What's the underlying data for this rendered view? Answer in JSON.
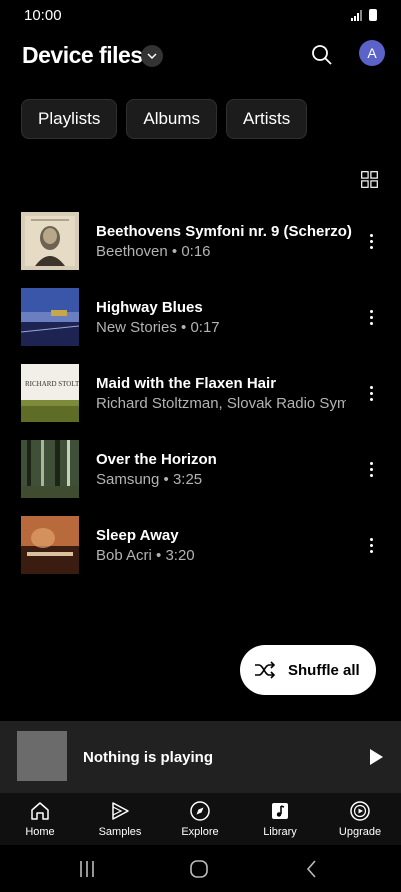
{
  "status_bar": {
    "time": "10:00"
  },
  "header": {
    "title": "Device files",
    "avatar_letter": "A"
  },
  "chips": [
    {
      "label": "Playlists"
    },
    {
      "label": "Albums"
    },
    {
      "label": "Artists"
    }
  ],
  "tracks": [
    {
      "title": "Beethovens Symfoni nr. 9 (Scherzo)",
      "subtitle": "Beethoven • 0:16",
      "art": "beethoven-portrait"
    },
    {
      "title": "Highway Blues",
      "subtitle": "New Stories • 0:17",
      "art": "blue-landscape"
    },
    {
      "title": "Maid with the Flaxen Hair",
      "subtitle": "Richard Stoltzman, Slovak Radio Sym…",
      "art_text": "RICHARD STOLTZMAN"
    },
    {
      "title": "Over the Horizon",
      "subtitle": "Samsung • 3:25",
      "art": "forest"
    },
    {
      "title": "Sleep Away",
      "subtitle": "Bob Acri • 3:20",
      "art": "piano-warm"
    }
  ],
  "shuffle": {
    "label": "Shuffle all"
  },
  "mini_player": {
    "text": "Nothing is playing"
  },
  "bottom_nav": [
    {
      "label": "Home",
      "icon": "home-icon"
    },
    {
      "label": "Samples",
      "icon": "samples-icon"
    },
    {
      "label": "Explore",
      "icon": "compass-icon"
    },
    {
      "label": "Library",
      "icon": "library-icon"
    },
    {
      "label": "Upgrade",
      "icon": "upgrade-icon"
    }
  ],
  "colors": {
    "accent": "#5b63c9",
    "background": "#000000",
    "mini_player_bg": "#212121"
  }
}
